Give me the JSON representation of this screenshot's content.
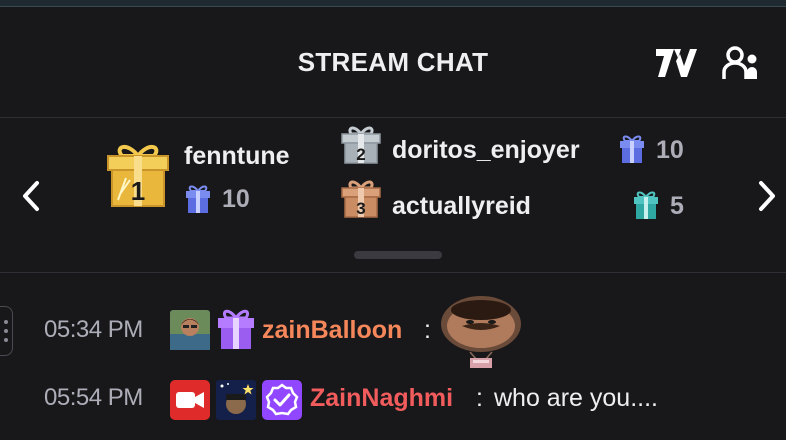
{
  "header": {
    "title": "STREAM CHAT",
    "icons": [
      "7tv-icon",
      "community-icon"
    ]
  },
  "leaderboard": {
    "top": {
      "rank": "1",
      "name": "fenntune",
      "count": "10"
    },
    "second": {
      "rank": "2",
      "name": "doritos_enjoyer",
      "count": "10"
    },
    "third": {
      "rank": "3",
      "name": "actuallyreid",
      "count": "5"
    }
  },
  "messages": [
    {
      "time": "05:34 PM",
      "user": "zainBalloon",
      "user_color": "#f5875a",
      "text": "",
      "emote": "face-balloon-emote"
    },
    {
      "time": "05:54 PM",
      "user": "ZainNaghmi",
      "user_color": "#f25c5c",
      "text": "who are you...."
    }
  ],
  "colors": {
    "background": "#18181b",
    "gold": "#e8b73c",
    "silver": "#a9b1b8",
    "bronze": "#c98c63",
    "sub_gift": "#7b8cf0",
    "purple": "#9147ff"
  }
}
